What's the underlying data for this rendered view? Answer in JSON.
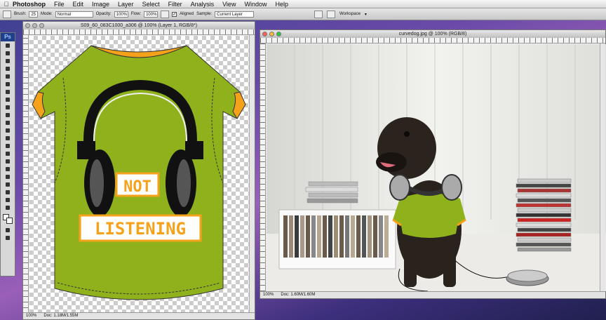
{
  "menubar": {
    "app": "Photoshop",
    "items": [
      "File",
      "Edit",
      "Image",
      "Layer",
      "Select",
      "Filter",
      "Analysis",
      "View",
      "Window",
      "Help"
    ]
  },
  "options": {
    "brush_label": "Brush:",
    "brush_size": "25",
    "mode_label": "Mode:",
    "mode_value": "Normal",
    "opacity_label": "Opacity:",
    "opacity_value": "100%",
    "flow_label": "Flow:",
    "flow_value": "100%",
    "aligned_label": "Aligned",
    "sample_label": "Sample:",
    "sample_value": "Current Layer",
    "workspace_label": "Workspace"
  },
  "tools": {
    "logo": "Ps"
  },
  "doc1": {
    "title": "S09_60_083C1000_a306 @ 100% (Layer 1, RGB/8*)",
    "zoom": "100%",
    "doc_size": "Doc: 1.18M/1.55M",
    "shirt_text_1": "NOT",
    "shirt_text_2": "LISTENING"
  },
  "doc2": {
    "title": "curvedog.jpg @ 100% (RGB/8)",
    "zoom": "100%",
    "doc_size": "Doc: 1.60M/1.60M"
  },
  "colors": {
    "shirt_green": "#8fb11c",
    "shirt_trim": "#f5a21a",
    "headphone": "#111111"
  }
}
